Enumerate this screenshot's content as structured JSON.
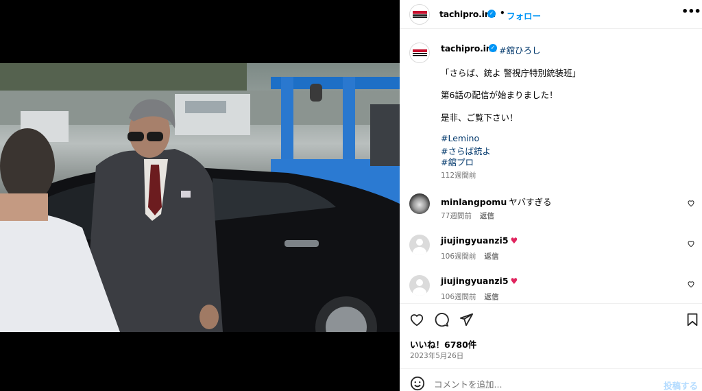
{
  "colors": {
    "accent": "#0095f6",
    "link": "#00376b",
    "muted": "#737373",
    "like_red": "#e0245e"
  },
  "post": {
    "photo_alt": "media"
  },
  "header": {
    "username": "tachipro.inc",
    "verified_icon": "verified-badge-icon",
    "separator": "•",
    "follow_label": "フォロー",
    "more_label": "•••"
  },
  "caption": {
    "username": "tachipro.inc",
    "mention": "#舘ひろし",
    "lines": [
      "「さらば、銃よ 警視庁特別銃装班」",
      "第6話の配信が始まりました！",
      "是非、ご覧下さい！"
    ],
    "hashtags": [
      "#Lemino",
      "#さらば銃よ",
      "#舘プロ"
    ],
    "time": "112週間前"
  },
  "comments": [
    {
      "username": "minlangpomu",
      "text": "ヤバすぎる",
      "time": "77週間前",
      "reply": "返信",
      "heart": false
    },
    {
      "username": "jiujingyuanzi5",
      "text": "",
      "time": "106週間前",
      "reply": "返信",
      "heart": true
    },
    {
      "username": "jiujingyuanzi5",
      "text": "",
      "time": "106週間前",
      "reply": "返信",
      "heart": true
    }
  ],
  "actions": {
    "likes": "いいね！6780件",
    "date": "2023年5月26日"
  },
  "composer": {
    "placeholder": "コメントを追加...",
    "post_label": "投稿する"
  }
}
